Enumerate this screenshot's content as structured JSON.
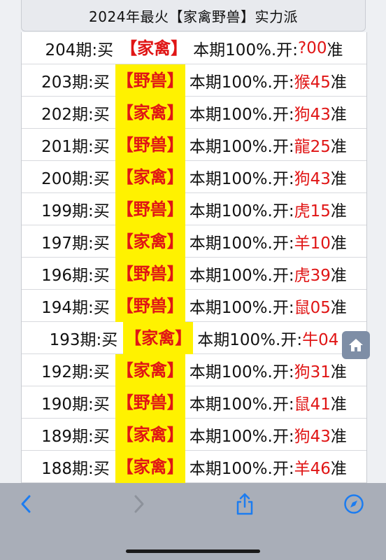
{
  "header": {
    "title": "2024年最火【家禽野兽】实力派"
  },
  "rows": [
    {
      "period": "204期:买",
      "pick": "【家禽】",
      "accuracy": "本期100%.开:",
      "result": "?00",
      "suffix": "准"
    },
    {
      "period": "203期:买",
      "pick": "【野兽】",
      "accuracy": "本期100%.开:",
      "result": "猴45",
      "suffix": "准"
    },
    {
      "period": "202期:买",
      "pick": "【家禽】",
      "accuracy": "本期100%.开:",
      "result": "狗43",
      "suffix": "准"
    },
    {
      "period": "201期:买",
      "pick": "【野兽】",
      "accuracy": "本期100%.开:",
      "result": "龍25",
      "suffix": "准"
    },
    {
      "period": "200期:买",
      "pick": "【家禽】",
      "accuracy": "本期100%.开:",
      "result": "狗43",
      "suffix": "准"
    },
    {
      "period": "199期:买",
      "pick": "【野兽】",
      "accuracy": "本期100%.开:",
      "result": "虎15",
      "suffix": "准"
    },
    {
      "period": "197期:买",
      "pick": "【家禽】",
      "accuracy": "本期100%.开:",
      "result": "羊10",
      "suffix": "准"
    },
    {
      "period": "196期:买",
      "pick": "【野兽】",
      "accuracy": "本期100%.开:",
      "result": "虎39",
      "suffix": "准"
    },
    {
      "period": "194期:买",
      "pick": "【野兽】",
      "accuracy": "本期100%.开:",
      "result": "鼠05",
      "suffix": "准"
    },
    {
      "period": "193期:买",
      "pick": "【家禽】",
      "accuracy": "本期100%.开:",
      "result": "牛04",
      "suffix": ""
    },
    {
      "period": "192期:买",
      "pick": "【家禽】",
      "accuracy": "本期100%.开:",
      "result": "狗31",
      "suffix": "准"
    },
    {
      "period": "190期:买",
      "pick": "【野兽】",
      "accuracy": "本期100%.开:",
      "result": "鼠41",
      "suffix": "准"
    },
    {
      "period": "189期:买",
      "pick": "【家禽】",
      "accuracy": "本期100%.开:",
      "result": "狗43",
      "suffix": "准"
    },
    {
      "period": "188期:买",
      "pick": "【家禽】",
      "accuracy": "本期100%.开:",
      "result": "羊46",
      "suffix": "准"
    }
  ],
  "floating": {
    "icon": "home-icon"
  },
  "toolbar": {
    "back_icon": "chevron-left-icon",
    "forward_icon": "chevron-right-icon",
    "share_icon": "share-icon",
    "browser_icon": "compass-icon"
  },
  "colors": {
    "accent_red": "#e01515",
    "highlight_yellow": "#fff200",
    "toolbar_blue": "#1c7cf0"
  }
}
